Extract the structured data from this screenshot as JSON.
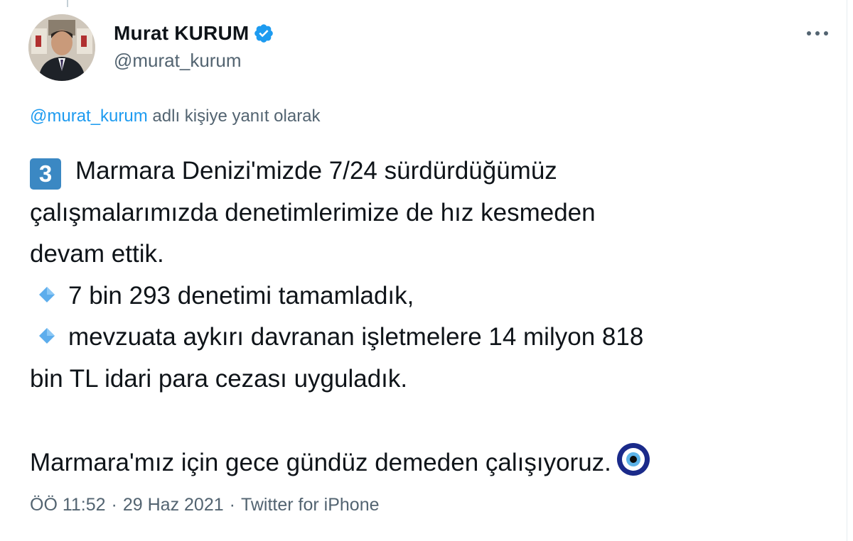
{
  "author": {
    "display_name": "Murat KURUM",
    "handle": "@murat_kurum",
    "verified": true
  },
  "reply_context": {
    "mention": "@murat_kurum",
    "suffix": " adlı kişiye yanıt olarak"
  },
  "tweet": {
    "keycap": "3",
    "lines": [
      "Marmara Denizi'mizde 7/24 sürdürdüğümüz",
      "çalışmalarımızda denetimlerimize de hız kesmeden",
      "devam ettik.",
      "7 bin 293 denetimi tamamladık,",
      "mevzuata aykırı davranan işletmelere 14 milyon 818",
      "bin TL idari para cezası uyguladık.",
      "",
      "Marmara'mız için gece gündüz demeden çalışıyoruz."
    ]
  },
  "meta": {
    "time": "ÖÖ 11:52",
    "separator": "·",
    "date": "29 Haz 2021",
    "source": "Twitter for iPhone"
  },
  "icons": {
    "more": "more-horizontal-icon",
    "verified": "verified-badge-icon",
    "bullet": "small-blue-diamond-icon",
    "keycap": "keycap-3-icon",
    "end_emoji": "nazar-amulet-icon"
  },
  "colors": {
    "link": "#1d9bf0",
    "secondary_text": "#536471",
    "primary_text": "#0f1419",
    "keycap_bg": "#3b88c3",
    "diamond": "#5dadec"
  }
}
